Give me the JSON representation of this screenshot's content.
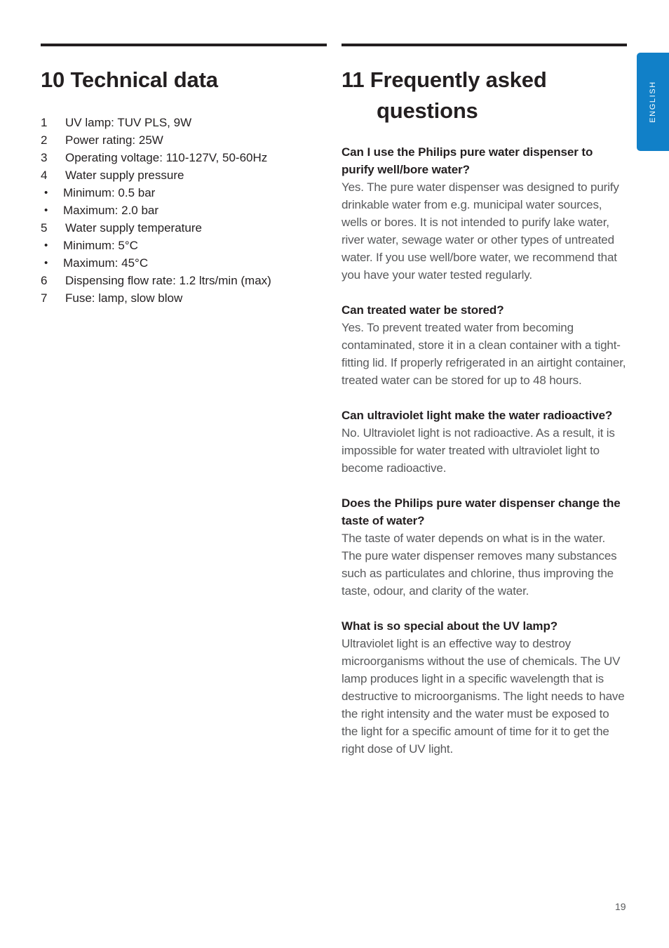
{
  "page": {
    "number": "19",
    "language_tab": "ENGLISH",
    "accent_color": "#1180c8",
    "rule_color": "#231f20",
    "heading_color": "#231f20",
    "body_color": "#58595b"
  },
  "left_column": {
    "heading": "10 Technical data",
    "specs": [
      {
        "num": "1",
        "text": "UV lamp: TUV PLS, 9W",
        "sub": []
      },
      {
        "num": "2",
        "text": "Power rating: 25W",
        "sub": []
      },
      {
        "num": "3",
        "text": "Operating voltage: 110-127V, 50-60Hz",
        "sub": []
      },
      {
        "num": "4",
        "text": "Water supply pressure",
        "sub": [
          "Minimum: 0.5 bar",
          "Maximum: 2.0 bar"
        ]
      },
      {
        "num": "5",
        "text": "Water supply temperature",
        "sub": [
          "Minimum: 5°C",
          "Maximum: 45°C"
        ]
      },
      {
        "num": "6",
        "text": "Dispensing flow rate: 1.2 ltrs/min (max)",
        "sub": []
      },
      {
        "num": "7",
        "text": "Fuse: lamp, slow blow",
        "sub": []
      }
    ],
    "bullet_glyph": "•"
  },
  "right_column": {
    "heading_line1": "11 Frequently asked",
    "heading_line2": "questions",
    "faqs": [
      {
        "question": "Can I use the Philips pure water dispenser to purify well/bore water?",
        "answer": "Yes. The pure water dispenser was designed to purify drinkable water from e.g. municipal water sources, wells or bores. It is not intended to purify lake water, river water, sewage water or other types of untreated water. If you use well/bore water, we recommend that you have your water tested regularly."
      },
      {
        "question": "Can treated water be stored?",
        "answer": "Yes. To prevent treated water from becoming contaminated, store it in a clean container with a tight-fitting lid. If properly refrigerated in an airtight container, treated water can be stored for up to 48 hours."
      },
      {
        "question": "Can ultraviolet light make the water radioactive?",
        "answer": "No. Ultraviolet light is not radioactive. As a result, it is impossible for water treated with ultraviolet light to become radioactive."
      },
      {
        "question": "Does the Philips pure water dispenser change the taste of water?",
        "answer": "The taste of water depends on what is in the water. The pure water dispenser removes many substances such as particulates and chlorine, thus improving the taste, odour, and clarity of the water."
      },
      {
        "question": "What is so special about the UV lamp?",
        "answer": "Ultraviolet light is an effective way to destroy microorganisms without the use of chemicals. The UV lamp produces light in a specific wavelength that is destructive to microorganisms. The light needs to have the right intensity and the water must be exposed to the light for a specific amount of time for it to get the right dose of UV light."
      }
    ]
  }
}
